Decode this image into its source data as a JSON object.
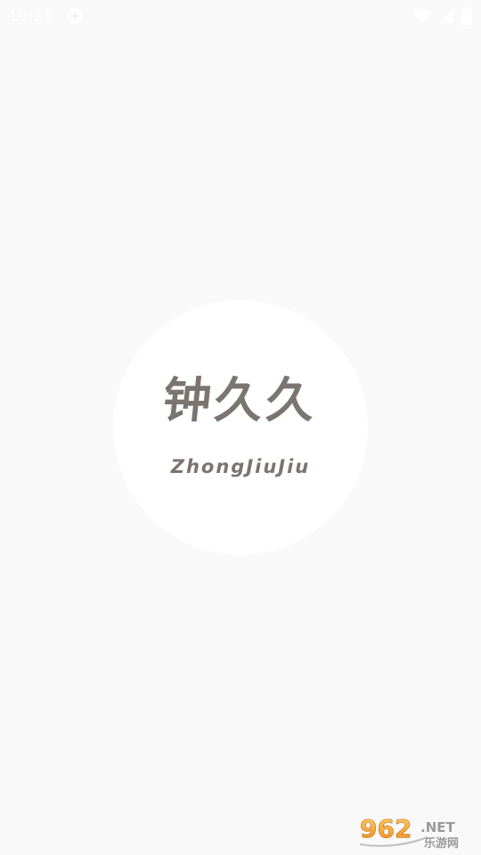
{
  "status_bar": {
    "time": "10:21",
    "icons": [
      "notification-icon",
      "wifi-icon",
      "signal-icon",
      "battery-icon"
    ]
  },
  "splash": {
    "app_name_cn": "钟久久",
    "app_name_en": "ZhongJiuJiu",
    "text_color": "#7b7570",
    "background": "#f9f9f9",
    "circle_color": "#ffffff"
  },
  "watermark": {
    "brand": "962.NET",
    "tagline": "乐游网"
  }
}
